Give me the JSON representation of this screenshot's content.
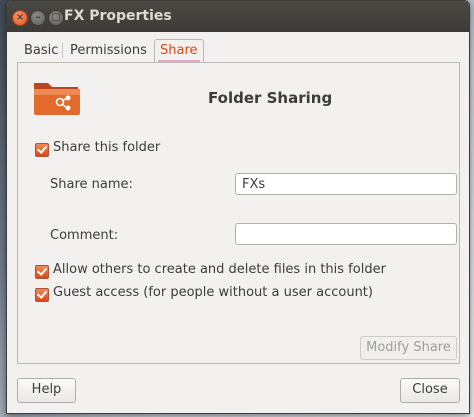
{
  "window": {
    "title": "FX Properties",
    "buttons": {
      "close": "×",
      "minimize": "–",
      "maximize": "□"
    }
  },
  "tabs": [
    {
      "label": "Basic"
    },
    {
      "label": "Permissions"
    },
    {
      "label": "Share",
      "active": true
    }
  ],
  "share": {
    "heading": "Folder Sharing",
    "share_folder_label": "Share this folder",
    "share_folder_checked": true,
    "share_name_label": "Share name:",
    "share_name_value": "FXs",
    "comment_label": "Comment:",
    "comment_value": "",
    "allow_others_label": "Allow others to create and delete files in this folder",
    "allow_others_checked": true,
    "guest_access_label": "Guest access (for people without a user account)",
    "guest_access_checked": true,
    "modify_share_label": "Modify Share"
  },
  "footer": {
    "help_label": "Help",
    "close_label": "Close"
  },
  "colors": {
    "accent": "#dd4814",
    "titlebar": "#3c3b37",
    "window_bg": "#f2f1f0",
    "folder": "#e26a2c"
  },
  "icons": {
    "folder_icon": "folder-share-icon",
    "checkbox": "checkbox-checked-icon"
  }
}
